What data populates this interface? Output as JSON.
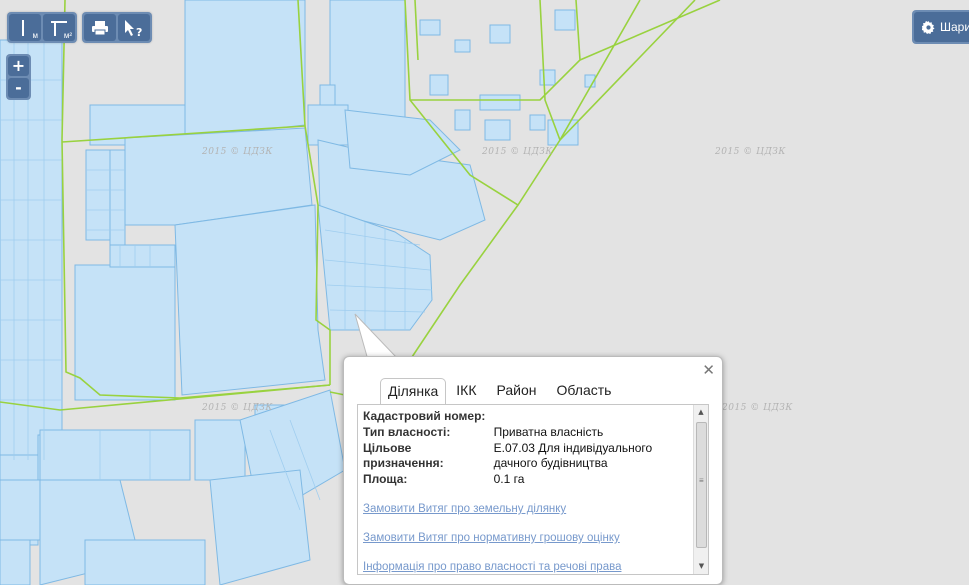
{
  "toolbar": {
    "measure_line_sub": "м",
    "measure_area_sub": "м²",
    "layers_label": "Шари"
  },
  "zoom": {
    "in_label": "+",
    "out_label": "-"
  },
  "watermark_text": "2015 © ЦДЗК",
  "popup": {
    "close_label": "✕",
    "tabs": [
      "Ділянка",
      "ІКК",
      "Район",
      "Область"
    ],
    "fields": [
      {
        "label": "Кадастровий номер:",
        "value": ""
      },
      {
        "label": "Тип власності:",
        "value": "Приватна власність"
      },
      {
        "label": "Цільове призначення:",
        "value": "Е.07.03 Для індивідуального дачного будівництва"
      },
      {
        "label": "Площа:",
        "value": "0.1 га"
      }
    ],
    "links": [
      "Замовити Витяг про земельну ділянку",
      "Замовити Витяг про нормативну грошову оцінку",
      "Інформація про право власності та речові права"
    ]
  },
  "colors": {
    "parcel_fill": "#c5e2f7",
    "parcel_stroke": "#7fb9e4",
    "boundary": "#99d23f",
    "map_bg": "#e3e3e3",
    "button": "#4b6d99"
  }
}
